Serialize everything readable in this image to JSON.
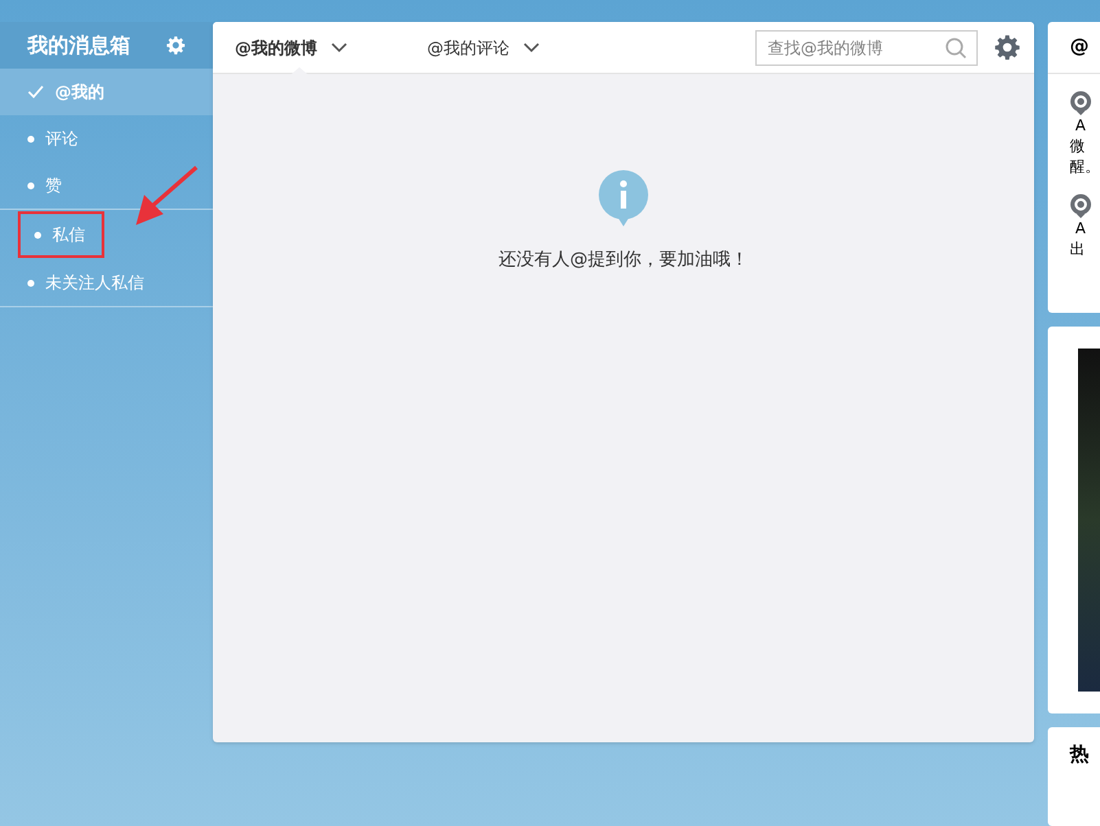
{
  "sidebar": {
    "title": "我的消息箱",
    "items": [
      {
        "label": "@我的",
        "selected": true,
        "highlighted": false
      },
      {
        "label": "评论",
        "selected": false,
        "highlighted": false
      },
      {
        "label": "赞",
        "selected": false,
        "highlighted": false
      },
      {
        "label": "私信",
        "selected": false,
        "highlighted": true
      },
      {
        "label": "未关注人私信",
        "selected": false,
        "highlighted": false
      }
    ]
  },
  "tabs": [
    {
      "label": "@我的微博",
      "selected": true
    },
    {
      "label": "@我的评论",
      "selected": false
    }
  ],
  "search": {
    "placeholder": "查找@我的微博"
  },
  "empty_message": "还没有人@提到你，要加油哦！",
  "right_panel": {
    "title": "@",
    "notices": [
      {
        "letter": "A",
        "lines": [
          "微",
          "醒。"
        ]
      },
      {
        "letter": "A",
        "lines": [
          "出"
        ]
      }
    ],
    "hot_title": "热"
  }
}
